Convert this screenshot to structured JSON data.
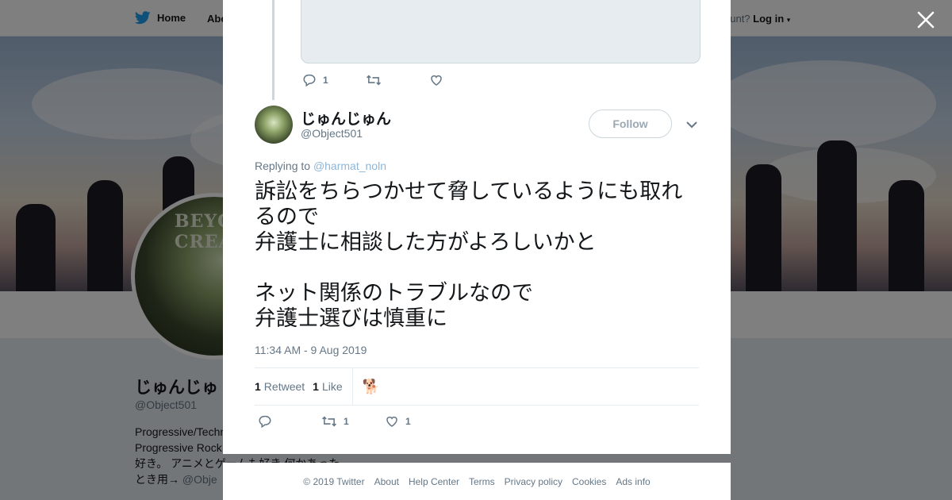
{
  "background_page": {
    "nav": {
      "home_label": "Home",
      "about_label": "Abo",
      "login_prefix": "ccount?",
      "login_label": "Log in"
    },
    "profile": {
      "name": "じゅんじゅ",
      "handle": "@Object501",
      "avatar_text": "BEYOND CREATION",
      "bio_lines": [
        "Progressive/Techn",
        "Progressive Rock",
        "好き。 アニメとゲームも好き 何かあった",
        "とき用→"
      ],
      "bio_mention": "@Obje"
    }
  },
  "previous_tweet": {
    "reply_count": "1"
  },
  "tweet": {
    "author_name": "じゅんじゅん",
    "author_handle": "@Object501",
    "follow_label": "Follow",
    "replying_label": "Replying to",
    "replying_to": "@harmat_noln",
    "text": "訴訟をちらつかせて脅しているようにも取れるので\n弁護士に相談した方がよろしいかと\n\nネット関係のトラブルなので\n弁護士選びは慎重に",
    "timestamp": "11:34 AM - 9 Aug 2019",
    "retweet_count": "1",
    "retweet_label": "Retweet",
    "like_count": "1",
    "like_label": "Like",
    "liker_avatar": "🐕",
    "action_retweet_count": "1",
    "action_like_count": "1"
  },
  "footer": {
    "links": [
      "© 2019 Twitter",
      "About",
      "Help Center",
      "Terms",
      "Privacy policy",
      "Cookies",
      "Ads info"
    ]
  },
  "colors": {
    "twitter_blue": "#1da1f2",
    "text_primary": "#14171a",
    "text_secondary": "#657786",
    "border": "#e6ecf0"
  }
}
